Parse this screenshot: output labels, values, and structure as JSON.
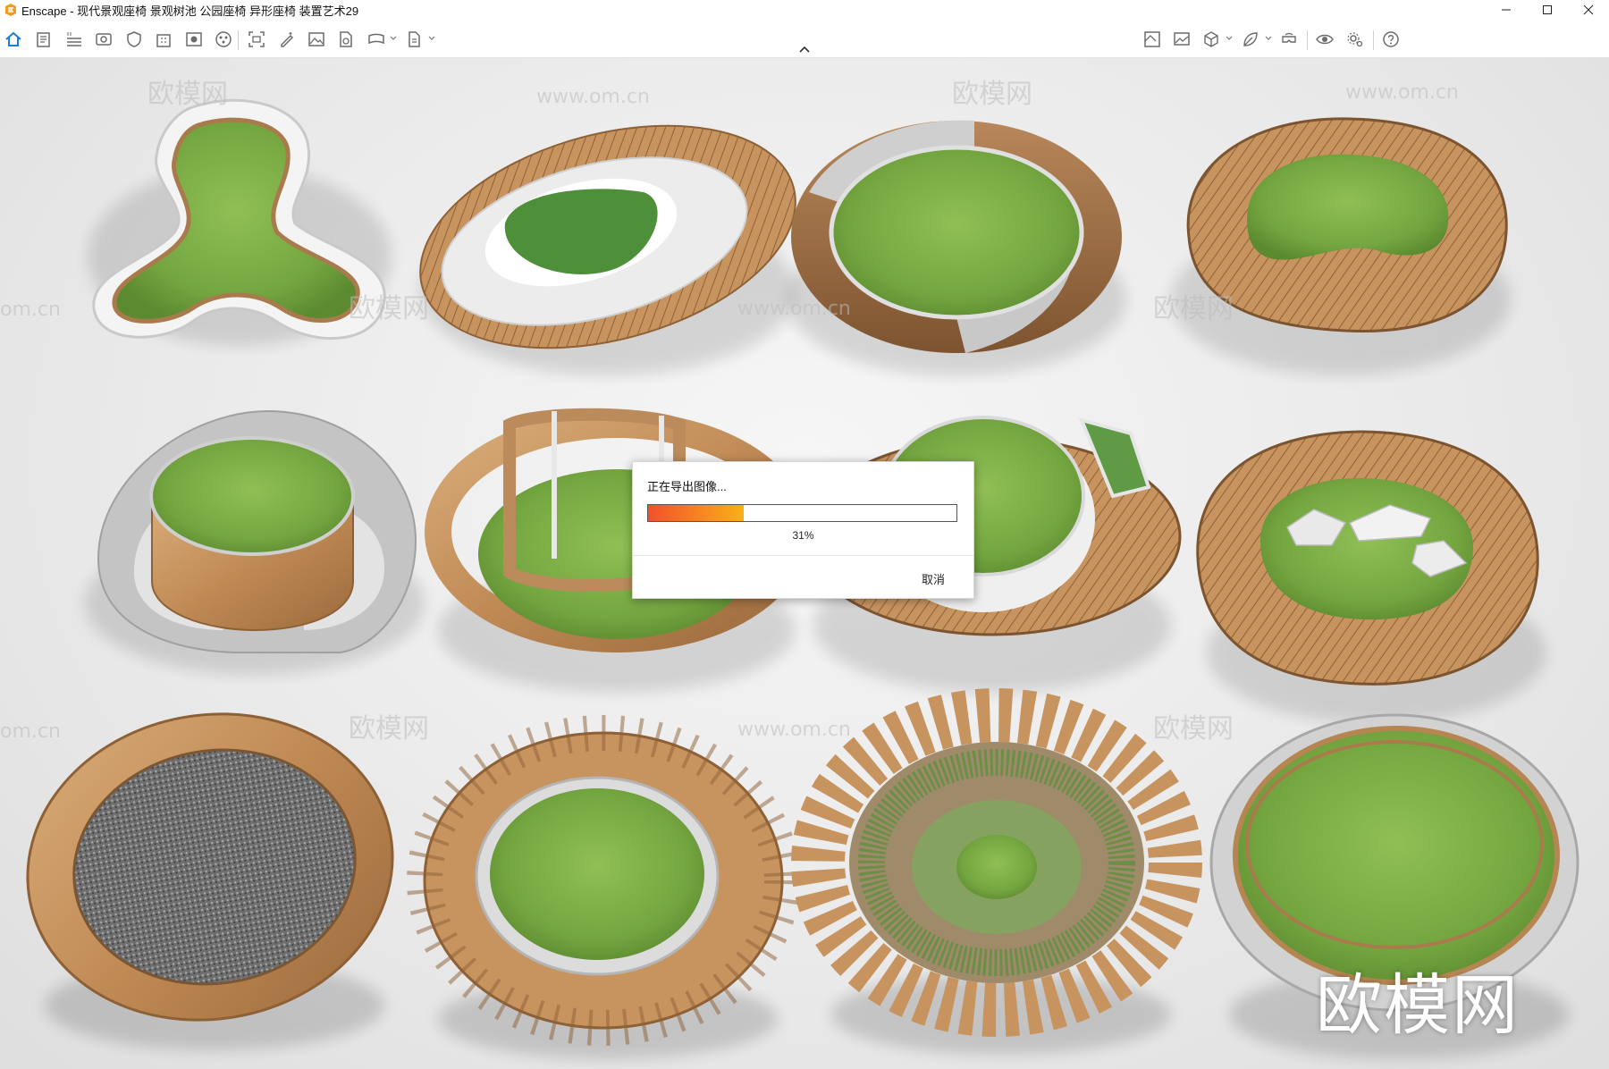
{
  "window": {
    "app_name": "Enscape",
    "title": "Enscape - 现代景观座椅 景观树池 公园座椅 异形座椅 装置艺术29",
    "controls": [
      "minimize-icon",
      "maximize-icon",
      "close-icon"
    ]
  },
  "toolbar": {
    "left_icons": [
      "home-icon",
      "notes-icon",
      "bim-icon",
      "views-icon",
      "safe-frame-icon",
      "building-icon",
      "info-panel-icon",
      "asset-library-icon",
      "screenshot-icon",
      "edit-icon",
      "image-icon",
      "export-file-icon",
      "panorama-icon",
      "batch-export-icon"
    ],
    "right_icons": [
      "material-editor-icon",
      "screenshot-gallery-icon",
      "cube-icon",
      "leaf-icon",
      "vr-headset-icon",
      "eye-icon",
      "settings-icon",
      "help-icon"
    ]
  },
  "viewport": {
    "watermark_small": [
      "欧模网",
      "www.om.cn",
      "om.cn"
    ],
    "watermark_large": "欧模网"
  },
  "export_dialog": {
    "title": "正在导出图像...",
    "progress_fraction": 0.31,
    "progress_text": "31%",
    "cancel_label": "取消",
    "accent_start": "#f4502a",
    "accent_end": "#fbb017"
  }
}
